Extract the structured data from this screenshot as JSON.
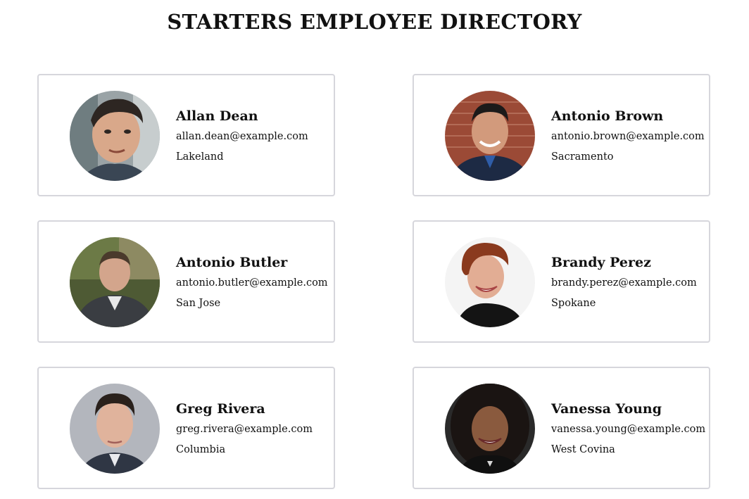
{
  "page": {
    "title": "STARTERS EMPLOYEE DIRECTORY"
  },
  "employees": [
    {
      "name": "Allan Dean",
      "email": "allan.dean@example.com",
      "city": "Lakeland"
    },
    {
      "name": "Antonio Brown",
      "email": "antonio.brown@example.com",
      "city": "Sacramento"
    },
    {
      "name": "Antonio Butler",
      "email": "antonio.butler@example.com",
      "city": "San Jose"
    },
    {
      "name": "Brandy Perez",
      "email": "brandy.perez@example.com",
      "city": "Spokane"
    },
    {
      "name": "Greg Rivera",
      "email": "greg.rivera@example.com",
      "city": "Columbia"
    },
    {
      "name": "Vanessa Young",
      "email": "vanessa.young@example.com",
      "city": "West Covina"
    }
  ],
  "colors": {
    "card_border": "#d6d6dc",
    "text": "#111111",
    "background": "#ffffff"
  }
}
